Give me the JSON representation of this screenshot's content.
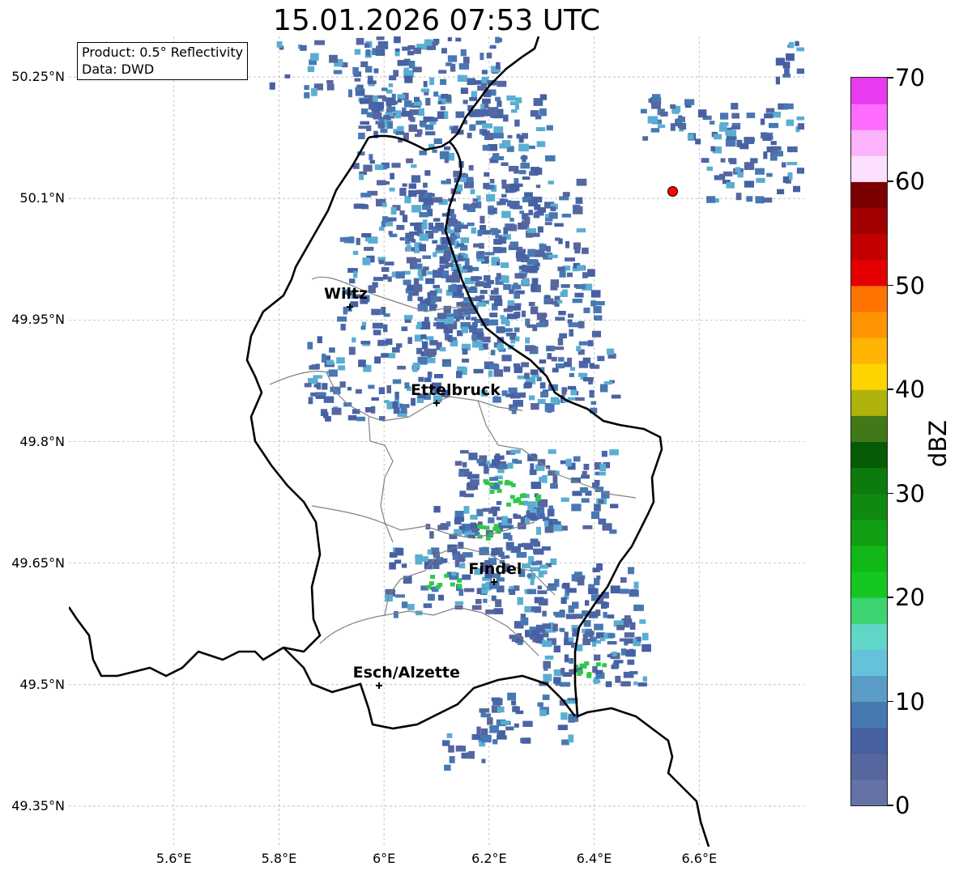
{
  "title": "15.01.2026 07:53 UTC",
  "info_box": {
    "product": "Product: 0.5° Reflectivity",
    "data": "Data: DWD"
  },
  "axes": {
    "lon_min": 5.4,
    "lon_max": 6.8,
    "lat_min": 49.3,
    "lat_max": 50.3,
    "lat_ticks": [
      {
        "value": 50.25,
        "label": "50.25°N"
      },
      {
        "value": 50.1,
        "label": "50.1°N"
      },
      {
        "value": 49.95,
        "label": "49.95°N"
      },
      {
        "value": 49.8,
        "label": "49.8°N"
      },
      {
        "value": 49.65,
        "label": "49.65°N"
      },
      {
        "value": 49.5,
        "label": "49.5°N"
      },
      {
        "value": 49.35,
        "label": "49.35°N"
      }
    ],
    "lon_ticks": [
      {
        "value": 5.6,
        "label": "5.6°E"
      },
      {
        "value": 5.8,
        "label": "5.8°E"
      },
      {
        "value": 6.0,
        "label": "6°E"
      },
      {
        "value": 6.2,
        "label": "6.2°E"
      },
      {
        "value": 6.4,
        "label": "6.4°E"
      },
      {
        "value": 6.6,
        "label": "6.6°E"
      }
    ],
    "grid": true
  },
  "cities": [
    {
      "name": "Wiltz",
      "lon": 5.935,
      "lat": 49.966
    },
    {
      "name": "Ettelbruck",
      "lon": 6.1,
      "lat": 49.847
    },
    {
      "name": "Findel",
      "lon": 6.21,
      "lat": 49.627
    },
    {
      "name": "Esch/Alzette",
      "lon": 5.99,
      "lat": 49.499
    }
  ],
  "radar_site": {
    "lon": 6.548,
    "lat": 50.109,
    "color": "#ff0000"
  },
  "colorbar": {
    "label": "dBZ",
    "min": 0,
    "max": 70,
    "ticks": [
      {
        "value": 0,
        "label": "0"
      },
      {
        "value": 10,
        "label": "10"
      },
      {
        "value": 20,
        "label": "20"
      },
      {
        "value": 30,
        "label": "30"
      },
      {
        "value": 40,
        "label": "40"
      },
      {
        "value": 50,
        "label": "50"
      },
      {
        "value": 60,
        "label": "60"
      },
      {
        "value": 70,
        "label": "70"
      }
    ],
    "colors": [
      "#6472a6",
      "#56669e",
      "#4660a2",
      "#4878b2",
      "#5a9cc6",
      "#66c2da",
      "#60d6c6",
      "#3cd470",
      "#14c820",
      "#12b818",
      "#109e12",
      "#0e8a10",
      "#0c7a0c",
      "#065c06",
      "#427818",
      "#aeb20a",
      "#fed400",
      "#feb400",
      "#fe9400",
      "#fe7400",
      "#e40000",
      "#c20000",
      "#a00000",
      "#7c0000",
      "#fde0fe",
      "#fdb2fe",
      "#fd6cfe",
      "#e83aee"
    ]
  },
  "colors": {
    "echo_low": "#4a66a6",
    "echo_mid": "#5aaed2",
    "echo_green": "#2ec84a",
    "border_national": "#000000",
    "border_canton": "#808080",
    "grid": "#b8b8b8"
  }
}
